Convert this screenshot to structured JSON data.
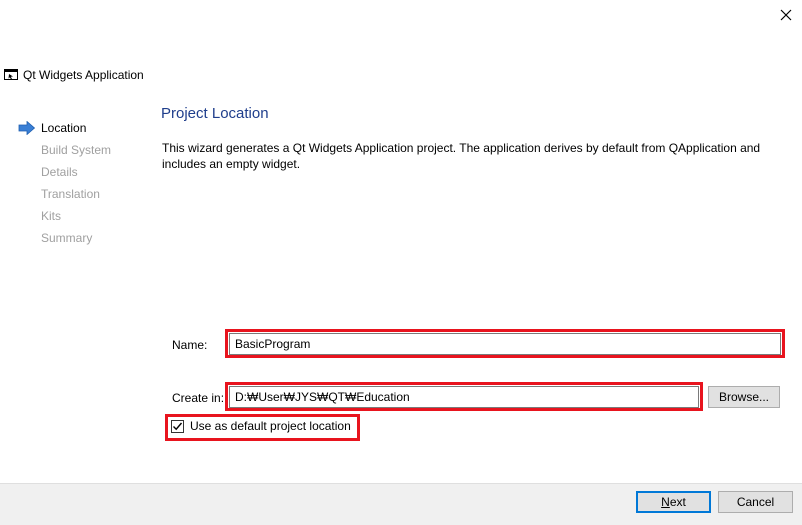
{
  "window": {
    "app_title": "Qt Widgets Application",
    "close_glyph": "✕"
  },
  "steps": [
    {
      "label": "Location",
      "active": true
    },
    {
      "label": "Build System",
      "active": false
    },
    {
      "label": "Details",
      "active": false
    },
    {
      "label": "Translation",
      "active": false
    },
    {
      "label": "Kits",
      "active": false
    },
    {
      "label": "Summary",
      "active": false
    }
  ],
  "page": {
    "title": "Project Location",
    "description": "This wizard generates a Qt Widgets Application project. The application derives by default from QApplication and includes an empty widget."
  },
  "form": {
    "name_label": "Name:",
    "name_value": "BasicProgram",
    "create_in_label": "Create in:",
    "create_in_value": "D:₩User₩JYS₩QT₩Education",
    "browse_label": "Browse...",
    "default_location_label": "Use as default project location",
    "default_location_checked": true
  },
  "buttons": {
    "next_mnemonic": "N",
    "next_rest": "ext",
    "cancel_label": "Cancel"
  },
  "colors": {
    "title": "#1f3e8c",
    "highlight": "#e8141e",
    "active_arrow": "#3a7fd5",
    "default_button_border": "#0078d7"
  }
}
